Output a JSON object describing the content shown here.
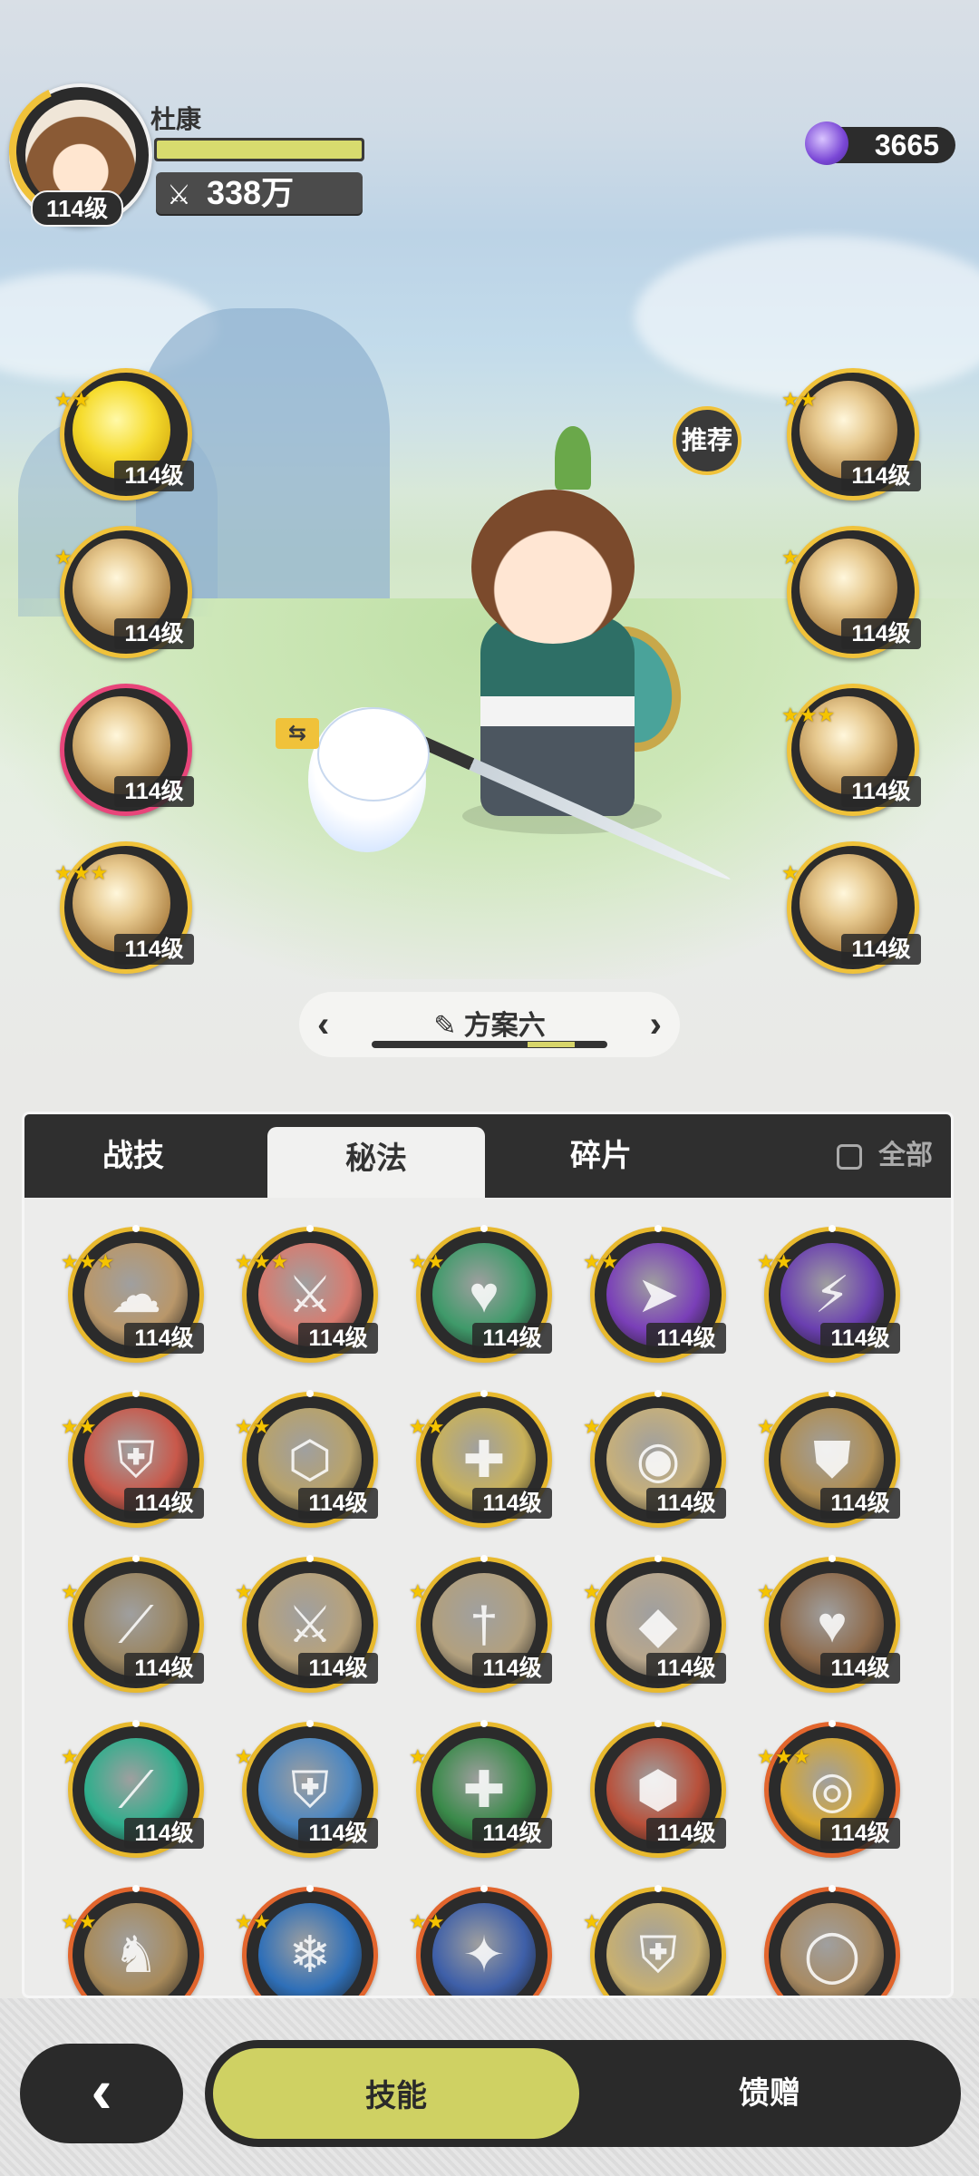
{
  "player": {
    "name": "杜康",
    "level": "114级",
    "power": "338万",
    "gems": "3665"
  },
  "left_slots": [
    {
      "level": "114级",
      "stars": "★★",
      "style": "gold"
    },
    {
      "level": "114级",
      "stars": "★",
      "style": ""
    },
    {
      "level": "114级",
      "stars": "",
      "style": "pink"
    },
    {
      "level": "114级",
      "stars": "★★★",
      "style": ""
    }
  ],
  "right_slots": [
    {
      "level": "114级",
      "stars": "★★"
    },
    {
      "level": "114级",
      "stars": "★"
    },
    {
      "level": "114级",
      "stars": "★★★"
    },
    {
      "level": "114级",
      "stars": "★"
    }
  ],
  "recommend_label": "推荐",
  "swap_glyph": "⇆",
  "loadout": {
    "name": "方案六",
    "prev": "‹",
    "next": "›",
    "edit_icon": "✎"
  },
  "tabs": {
    "combat": "战技",
    "secret": "秘法",
    "fragments": "碎片",
    "all": "全部"
  },
  "skills": [
    {
      "level": "114级",
      "stars": "★★★",
      "glyph": "☁",
      "color": "#b9976a",
      "ring": "gold"
    },
    {
      "level": "114级",
      "stars": "★★★",
      "glyph": "⚔",
      "color": "#d97a6e",
      "ring": "gold"
    },
    {
      "level": "114级",
      "stars": "★★",
      "glyph": "♥",
      "color": "#3f9a6a",
      "ring": "gold"
    },
    {
      "level": "114级",
      "stars": "★★",
      "glyph": "➤",
      "color": "#7a3fb8",
      "ring": "gold"
    },
    {
      "level": "114级",
      "stars": "★★",
      "glyph": "⚡",
      "color": "#6a3fb0",
      "ring": "gold"
    },
    {
      "level": "114级",
      "stars": "★★",
      "glyph": "⛨",
      "color": "#c9584a",
      "ring": "gold"
    },
    {
      "level": "114级",
      "stars": "★★",
      "glyph": "⬡",
      "color": "#b8a26a",
      "ring": "gold"
    },
    {
      "level": "114级",
      "stars": "★★",
      "glyph": "✚",
      "color": "#c9b25a",
      "ring": "gold"
    },
    {
      "level": "114级",
      "stars": "★",
      "glyph": "◉",
      "color": "#c7b07a",
      "ring": "gold"
    },
    {
      "level": "114级",
      "stars": "★",
      "glyph": "⛊",
      "color": "#b08e52",
      "ring": "gold"
    },
    {
      "level": "114级",
      "stars": "★",
      "glyph": "⟋",
      "color": "#9a8560",
      "ring": "gold"
    },
    {
      "level": "114级",
      "stars": "★",
      "glyph": "⚔",
      "color": "#b8a27a",
      "ring": "gold"
    },
    {
      "level": "114级",
      "stars": "★",
      "glyph": "†",
      "color": "#b2a07e",
      "ring": "gold"
    },
    {
      "level": "114级",
      "stars": "★",
      "glyph": "◆",
      "color": "#b9a78c",
      "ring": "gold"
    },
    {
      "level": "114级",
      "stars": "★",
      "glyph": "♥",
      "color": "#8e6a4a",
      "ring": "gold"
    },
    {
      "level": "114级",
      "stars": "★",
      "glyph": "⟋",
      "color": "#2fae8c",
      "ring": "gold"
    },
    {
      "level": "114级",
      "stars": "★",
      "glyph": "⛨",
      "color": "#4a86c2",
      "ring": "gold"
    },
    {
      "level": "114级",
      "stars": "★",
      "glyph": "✚",
      "color": "#3a8a4a",
      "ring": "gold"
    },
    {
      "level": "114级",
      "stars": "",
      "glyph": "⬢",
      "color": "#b8503a",
      "ring": "gold"
    },
    {
      "level": "114级",
      "stars": "★★★",
      "glyph": "◎",
      "color": "#d8a830",
      "ring": "orange"
    },
    {
      "level": "",
      "stars": "★★",
      "glyph": "♞",
      "color": "#a88a5a",
      "ring": "orange"
    },
    {
      "level": "",
      "stars": "★★",
      "glyph": "❄",
      "color": "#2e6fb8",
      "ring": "orange"
    },
    {
      "level": "",
      "stars": "★★",
      "glyph": "✦",
      "color": "#3e5fa8",
      "ring": "orange"
    },
    {
      "level": "",
      "stars": "★",
      "glyph": "⛨",
      "color": "#c8b070",
      "ring": "gold"
    },
    {
      "level": "",
      "stars": "",
      "glyph": "◯",
      "color": "#a88a62",
      "ring": "orange"
    }
  ],
  "bottom": {
    "back": "‹",
    "skills": "技能",
    "gift": "馈赠"
  }
}
